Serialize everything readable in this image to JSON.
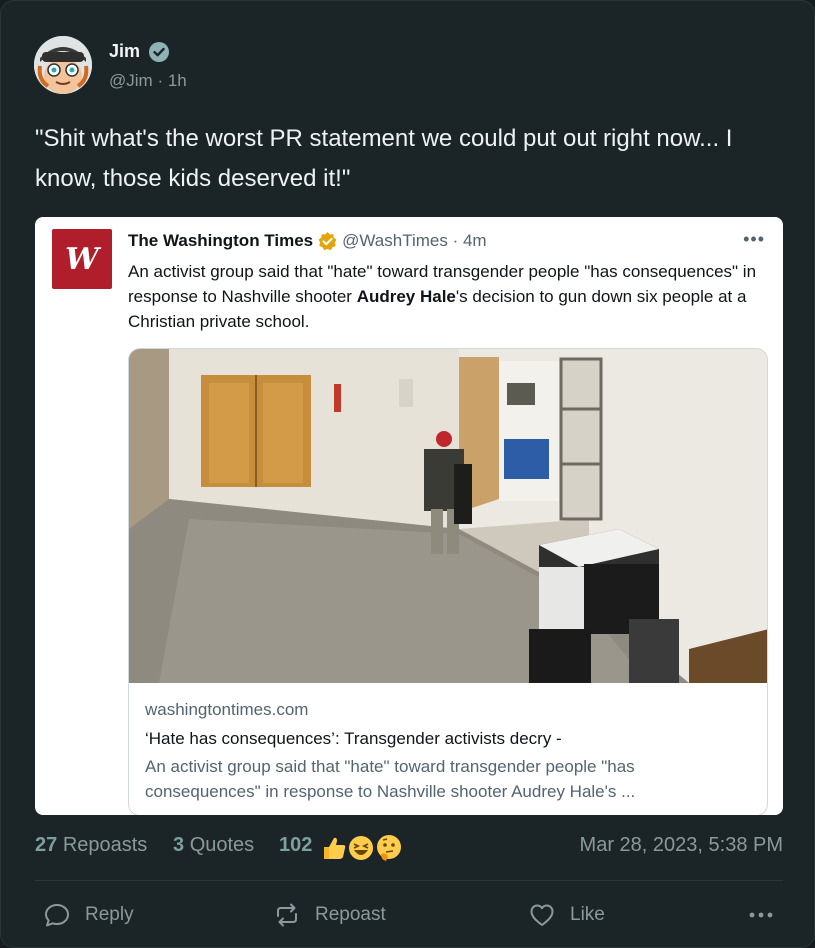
{
  "post": {
    "author_name": "Jim",
    "author_handle": "@Jim",
    "time_ago": "1h",
    "text": "\"Shit what's the worst PR statement we could put out right now... I know, those kids deserved it!\""
  },
  "quoted": {
    "logo_letter": "W",
    "name": "The Washington Times",
    "handle": "@WashTimes",
    "time_ago": "4m",
    "text_before": "An activist group said that \"hate\" toward transgender people \"has consequences\" in response to Nashville shooter ",
    "text_bold": "Audrey Hale",
    "text_after": "'s decision to gun down six people at a Christian private school.",
    "link": {
      "domain": "washingtontimes.com",
      "title": "‘Hate has consequences’: Transgender activists decry -",
      "description": "An activist group said that \"hate\" toward transgender people \"has consequences\" in response to Nashville shooter Audrey Hale's ..."
    }
  },
  "stats": {
    "reposts_count": "27",
    "reposts_label": "Repoasts",
    "quotes_count": "3",
    "quotes_label": "Quotes",
    "reactions_count": "102",
    "timestamp": "Mar 28, 2023, 5:38 PM"
  },
  "actions": {
    "reply": "Reply",
    "repost": "Repoast",
    "like": "Like"
  },
  "colors": {
    "background": "#1b2426",
    "verified": "#8fb3b4",
    "washington_times_red": "#b01e2c"
  }
}
